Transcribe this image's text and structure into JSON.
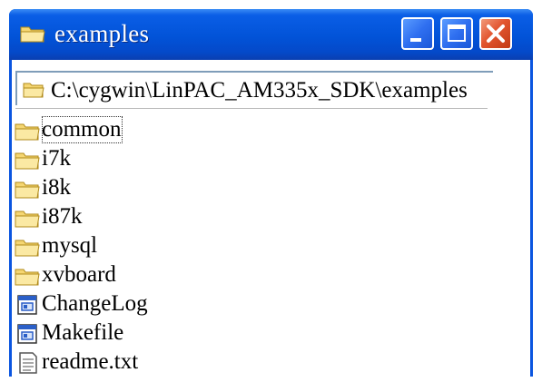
{
  "window": {
    "title": "examples",
    "title_icon": "folder-icon",
    "controls": {
      "minimize": "minimize-icon",
      "maximize": "maximize-icon",
      "close": "close-icon"
    },
    "colors": {
      "titlebar": "#0253d8",
      "close_button": "#e2552f"
    }
  },
  "address": {
    "icon": "folder-icon",
    "path": "C:\\cygwin\\LinPAC_AM335x_SDK\\examples"
  },
  "items": [
    {
      "name": "common",
      "type": "folder",
      "icon": "folder-icon",
      "focused": true
    },
    {
      "name": "i7k",
      "type": "folder",
      "icon": "folder-icon"
    },
    {
      "name": "i8k",
      "type": "folder",
      "icon": "folder-icon"
    },
    {
      "name": "i87k",
      "type": "folder",
      "icon": "folder-icon"
    },
    {
      "name": "mysql",
      "type": "folder",
      "icon": "folder-icon"
    },
    {
      "name": "xvboard",
      "type": "folder",
      "icon": "folder-icon"
    },
    {
      "name": "ChangeLog",
      "type": "file",
      "icon": "generic-file-icon"
    },
    {
      "name": "Makefile",
      "type": "file",
      "icon": "generic-file-icon"
    },
    {
      "name": "readme.txt",
      "type": "text",
      "icon": "text-file-icon"
    }
  ]
}
